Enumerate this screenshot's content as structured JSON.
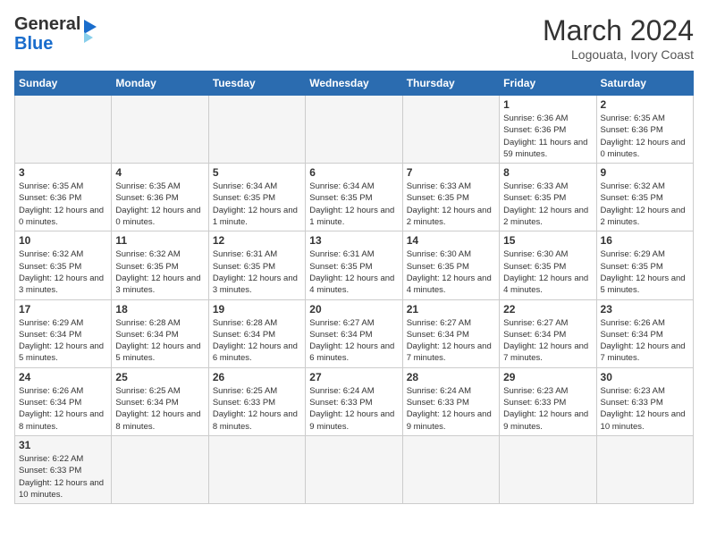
{
  "header": {
    "logo_general": "General",
    "logo_blue": "Blue",
    "month_year": "March 2024",
    "location": "Logouata, Ivory Coast"
  },
  "days_of_week": [
    "Sunday",
    "Monday",
    "Tuesday",
    "Wednesday",
    "Thursday",
    "Friday",
    "Saturday"
  ],
  "weeks": [
    [
      {
        "day": "",
        "info": ""
      },
      {
        "day": "",
        "info": ""
      },
      {
        "day": "",
        "info": ""
      },
      {
        "day": "",
        "info": ""
      },
      {
        "day": "",
        "info": ""
      },
      {
        "day": "1",
        "info": "Sunrise: 6:36 AM\nSunset: 6:36 PM\nDaylight: 11 hours\nand 59 minutes."
      },
      {
        "day": "2",
        "info": "Sunrise: 6:35 AM\nSunset: 6:36 PM\nDaylight: 12 hours\nand 0 minutes."
      }
    ],
    [
      {
        "day": "3",
        "info": "Sunrise: 6:35 AM\nSunset: 6:36 PM\nDaylight: 12 hours\nand 0 minutes."
      },
      {
        "day": "4",
        "info": "Sunrise: 6:35 AM\nSunset: 6:36 PM\nDaylight: 12 hours\nand 0 minutes."
      },
      {
        "day": "5",
        "info": "Sunrise: 6:34 AM\nSunset: 6:35 PM\nDaylight: 12 hours\nand 1 minute."
      },
      {
        "day": "6",
        "info": "Sunrise: 6:34 AM\nSunset: 6:35 PM\nDaylight: 12 hours\nand 1 minute."
      },
      {
        "day": "7",
        "info": "Sunrise: 6:33 AM\nSunset: 6:35 PM\nDaylight: 12 hours\nand 2 minutes."
      },
      {
        "day": "8",
        "info": "Sunrise: 6:33 AM\nSunset: 6:35 PM\nDaylight: 12 hours\nand 2 minutes."
      },
      {
        "day": "9",
        "info": "Sunrise: 6:32 AM\nSunset: 6:35 PM\nDaylight: 12 hours\nand 2 minutes."
      }
    ],
    [
      {
        "day": "10",
        "info": "Sunrise: 6:32 AM\nSunset: 6:35 PM\nDaylight: 12 hours\nand 3 minutes."
      },
      {
        "day": "11",
        "info": "Sunrise: 6:32 AM\nSunset: 6:35 PM\nDaylight: 12 hours\nand 3 minutes."
      },
      {
        "day": "12",
        "info": "Sunrise: 6:31 AM\nSunset: 6:35 PM\nDaylight: 12 hours\nand 3 minutes."
      },
      {
        "day": "13",
        "info": "Sunrise: 6:31 AM\nSunset: 6:35 PM\nDaylight: 12 hours\nand 4 minutes."
      },
      {
        "day": "14",
        "info": "Sunrise: 6:30 AM\nSunset: 6:35 PM\nDaylight: 12 hours\nand 4 minutes."
      },
      {
        "day": "15",
        "info": "Sunrise: 6:30 AM\nSunset: 6:35 PM\nDaylight: 12 hours\nand 4 minutes."
      },
      {
        "day": "16",
        "info": "Sunrise: 6:29 AM\nSunset: 6:35 PM\nDaylight: 12 hours\nand 5 minutes."
      }
    ],
    [
      {
        "day": "17",
        "info": "Sunrise: 6:29 AM\nSunset: 6:34 PM\nDaylight: 12 hours\nand 5 minutes."
      },
      {
        "day": "18",
        "info": "Sunrise: 6:28 AM\nSunset: 6:34 PM\nDaylight: 12 hours\nand 5 minutes."
      },
      {
        "day": "19",
        "info": "Sunrise: 6:28 AM\nSunset: 6:34 PM\nDaylight: 12 hours\nand 6 minutes."
      },
      {
        "day": "20",
        "info": "Sunrise: 6:27 AM\nSunset: 6:34 PM\nDaylight: 12 hours\nand 6 minutes."
      },
      {
        "day": "21",
        "info": "Sunrise: 6:27 AM\nSunset: 6:34 PM\nDaylight: 12 hours\nand 7 minutes."
      },
      {
        "day": "22",
        "info": "Sunrise: 6:27 AM\nSunset: 6:34 PM\nDaylight: 12 hours\nand 7 minutes."
      },
      {
        "day": "23",
        "info": "Sunrise: 6:26 AM\nSunset: 6:34 PM\nDaylight: 12 hours\nand 7 minutes."
      }
    ],
    [
      {
        "day": "24",
        "info": "Sunrise: 6:26 AM\nSunset: 6:34 PM\nDaylight: 12 hours\nand 8 minutes."
      },
      {
        "day": "25",
        "info": "Sunrise: 6:25 AM\nSunset: 6:34 PM\nDaylight: 12 hours\nand 8 minutes."
      },
      {
        "day": "26",
        "info": "Sunrise: 6:25 AM\nSunset: 6:33 PM\nDaylight: 12 hours\nand 8 minutes."
      },
      {
        "day": "27",
        "info": "Sunrise: 6:24 AM\nSunset: 6:33 PM\nDaylight: 12 hours\nand 9 minutes."
      },
      {
        "day": "28",
        "info": "Sunrise: 6:24 AM\nSunset: 6:33 PM\nDaylight: 12 hours\nand 9 minutes."
      },
      {
        "day": "29",
        "info": "Sunrise: 6:23 AM\nSunset: 6:33 PM\nDaylight: 12 hours\nand 9 minutes."
      },
      {
        "day": "30",
        "info": "Sunrise: 6:23 AM\nSunset: 6:33 PM\nDaylight: 12 hours\nand 10 minutes."
      }
    ],
    [
      {
        "day": "31",
        "info": "Sunrise: 6:22 AM\nSunset: 6:33 PM\nDaylight: 12 hours\nand 10 minutes."
      },
      {
        "day": "",
        "info": ""
      },
      {
        "day": "",
        "info": ""
      },
      {
        "day": "",
        "info": ""
      },
      {
        "day": "",
        "info": ""
      },
      {
        "day": "",
        "info": ""
      },
      {
        "day": "",
        "info": ""
      }
    ]
  ]
}
